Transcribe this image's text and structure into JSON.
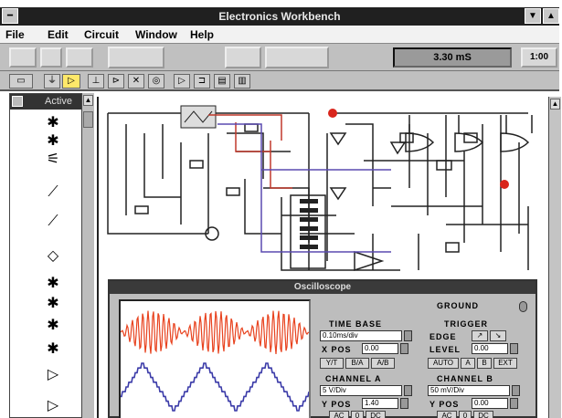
{
  "window": {
    "title": "Electronics Workbench"
  },
  "menu": [
    "File",
    "Edit",
    "Circuit",
    "Window",
    "Help"
  ],
  "toolbar": {
    "time_display": "3.30 mS",
    "zoom_display": "1:00"
  },
  "palette": {
    "title": "Active"
  },
  "oscilloscope": {
    "title": "Oscilloscope",
    "ground_label": "GROUND",
    "time_base": {
      "label": "TIME BASE",
      "value": "0.10ms/div",
      "pos_label": "X POS",
      "pos_value": "0.00"
    },
    "trigger": {
      "label": "TRIGGER",
      "edge_label": "EDGE",
      "level_label": "LEVEL",
      "level_value": "0.00"
    },
    "mode_buttons": [
      "Y/T",
      "B/A",
      "A/B"
    ],
    "trigger_buttons": [
      "AUTO",
      "A",
      "B",
      "EXT"
    ],
    "channel_a": {
      "label": "CHANNEL A",
      "value": "5 V/Div",
      "pos_label": "Y POS",
      "pos_value": "1.40",
      "ac": "AC",
      "zero": "0",
      "dc": "DC"
    },
    "channel_b": {
      "label": "CHANNEL B",
      "value": "50 mV/Div",
      "pos_label": "Y POS",
      "pos_value": "0.00",
      "ac": "AC",
      "zero": "0",
      "dc": "DC"
    },
    "trace_colors": {
      "channel_a": "#e8421e",
      "channel_b": "#3a3aa8"
    }
  }
}
